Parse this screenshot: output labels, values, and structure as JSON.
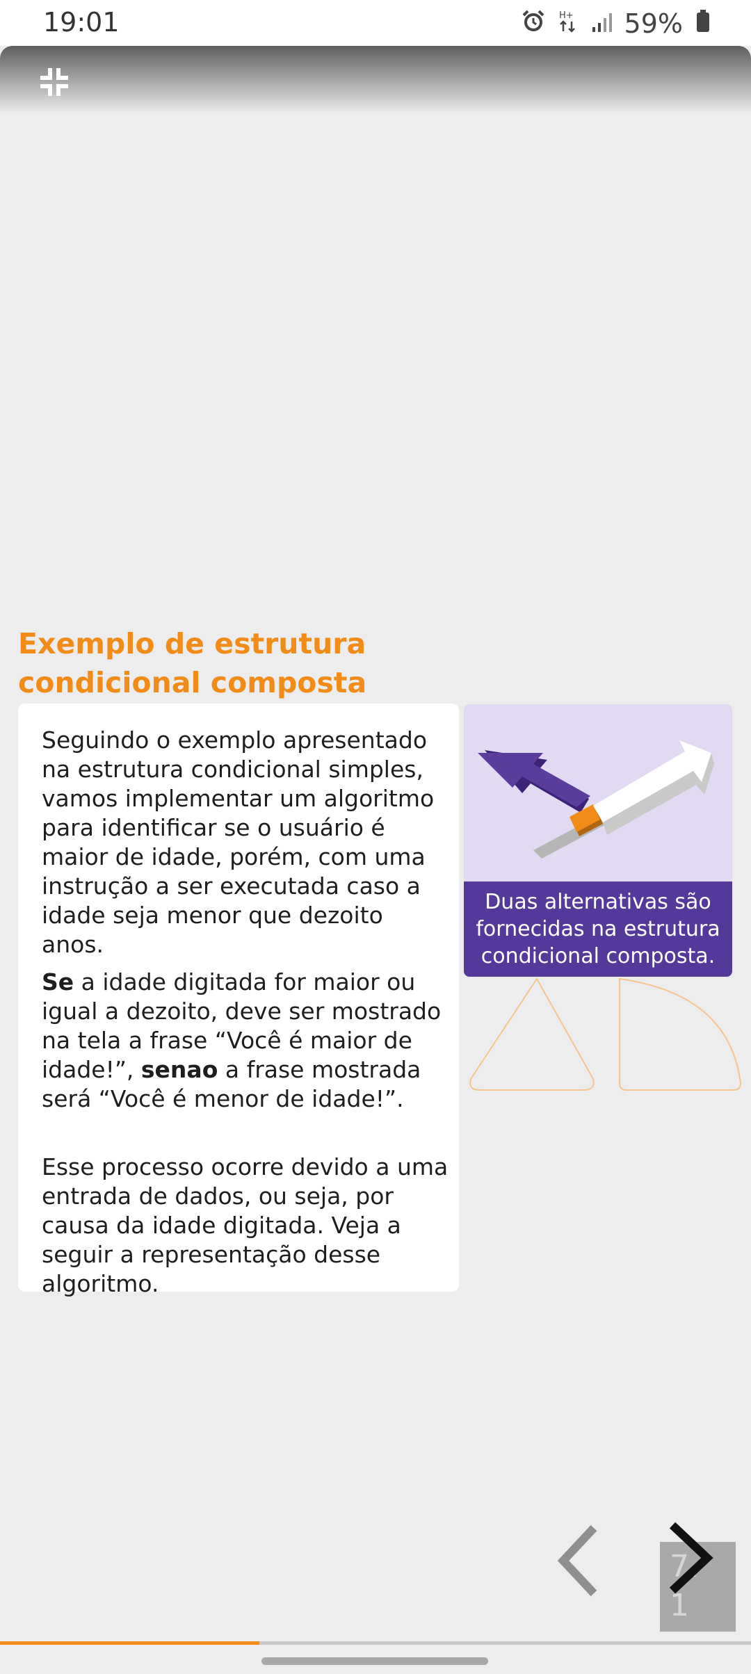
{
  "status_bar": {
    "time": "19:01",
    "battery": "59%",
    "icons": [
      "alarm-icon",
      "data-transfer-icon",
      "signal-icon",
      "battery-icon"
    ]
  },
  "toolbar": {
    "collapse_icon": "collapse-fullscreen-icon"
  },
  "content": {
    "title": "Exemplo de estrutura condicional composta",
    "paragraph1": "Seguindo o exemplo apresentado na estrutura condicional simples, vamos implementar um algoritmo para identificar se o usuário é maior de idade, porém, com uma instrução a ser executada caso a idade seja menor que dezoito anos.",
    "paragraph2": {
      "kw_se": "Se",
      "part1": " a idade digitada for maior ou igual a dezoito, deve ser mostrado na tela a frase “Você é maior de idade!”, ",
      "kw_senao": "senao",
      "part2": " a frase mostrada será “Você é menor de idade!”."
    },
    "paragraph3": "Esse processo ocorre devido a uma entrada de dados, ou seja, por causa da idade digitada. Veja a seguir a representação desse algoritmo.",
    "image_caption": "Duas alternativas são fornecidas na estrutura condicional composta."
  },
  "navigation": {
    "prev_icon": "chevron-left-icon",
    "next_icon": "chevron-right-icon",
    "page_top": "7.",
    "page_bottom": "1"
  },
  "progress": {
    "fraction": 0.345
  },
  "colors": {
    "accent": "#f28c18",
    "purple": "#55399a",
    "light_purple": "#e2d9f3"
  }
}
